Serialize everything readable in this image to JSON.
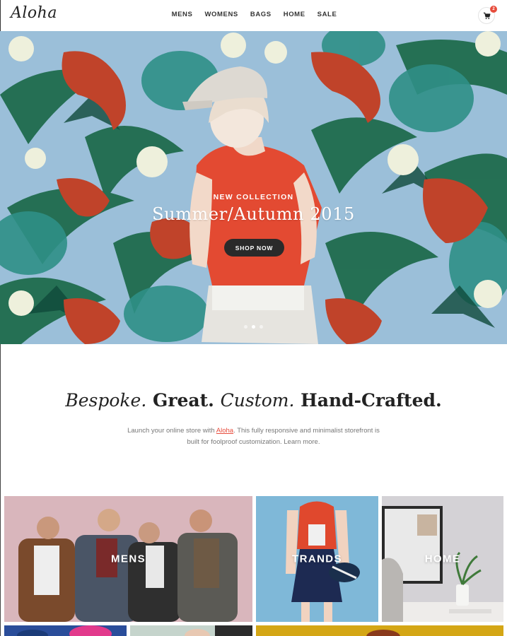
{
  "brand": {
    "logo": "Aloha"
  },
  "nav": {
    "items": [
      "MENS",
      "WOMENS",
      "BAGS",
      "HOME",
      "SALE"
    ]
  },
  "cart": {
    "icon": "cart-icon",
    "badge": "2"
  },
  "hero": {
    "kicker": "NEW COLLECTION",
    "title": "Summer/Autumn 2015",
    "button": "SHOP NOW",
    "active_slide": 2,
    "slide_count": 3
  },
  "intro": {
    "headline": {
      "w1": "Bespoke.",
      "w2": "Great.",
      "w3": "Custom.",
      "w4": "Hand-Crafted."
    },
    "text_before": "Launch your online store with ",
    "link": "Aloha",
    "text_after": ". This fully responsive and minimalist storefront is",
    "line2": "built for foolproof customization. Learn more."
  },
  "categories": {
    "mens": "MENS",
    "trands": "TRANDS",
    "home": "HOME"
  },
  "colors": {
    "accent": "#e74c3c",
    "dark_button": "#2a2a2a",
    "hero_sky": "#9bbfd9",
    "mens_bg": "#d9b6bc",
    "trands_bg": "#7fb8d8",
    "home_bg": "#d4d2d6"
  }
}
